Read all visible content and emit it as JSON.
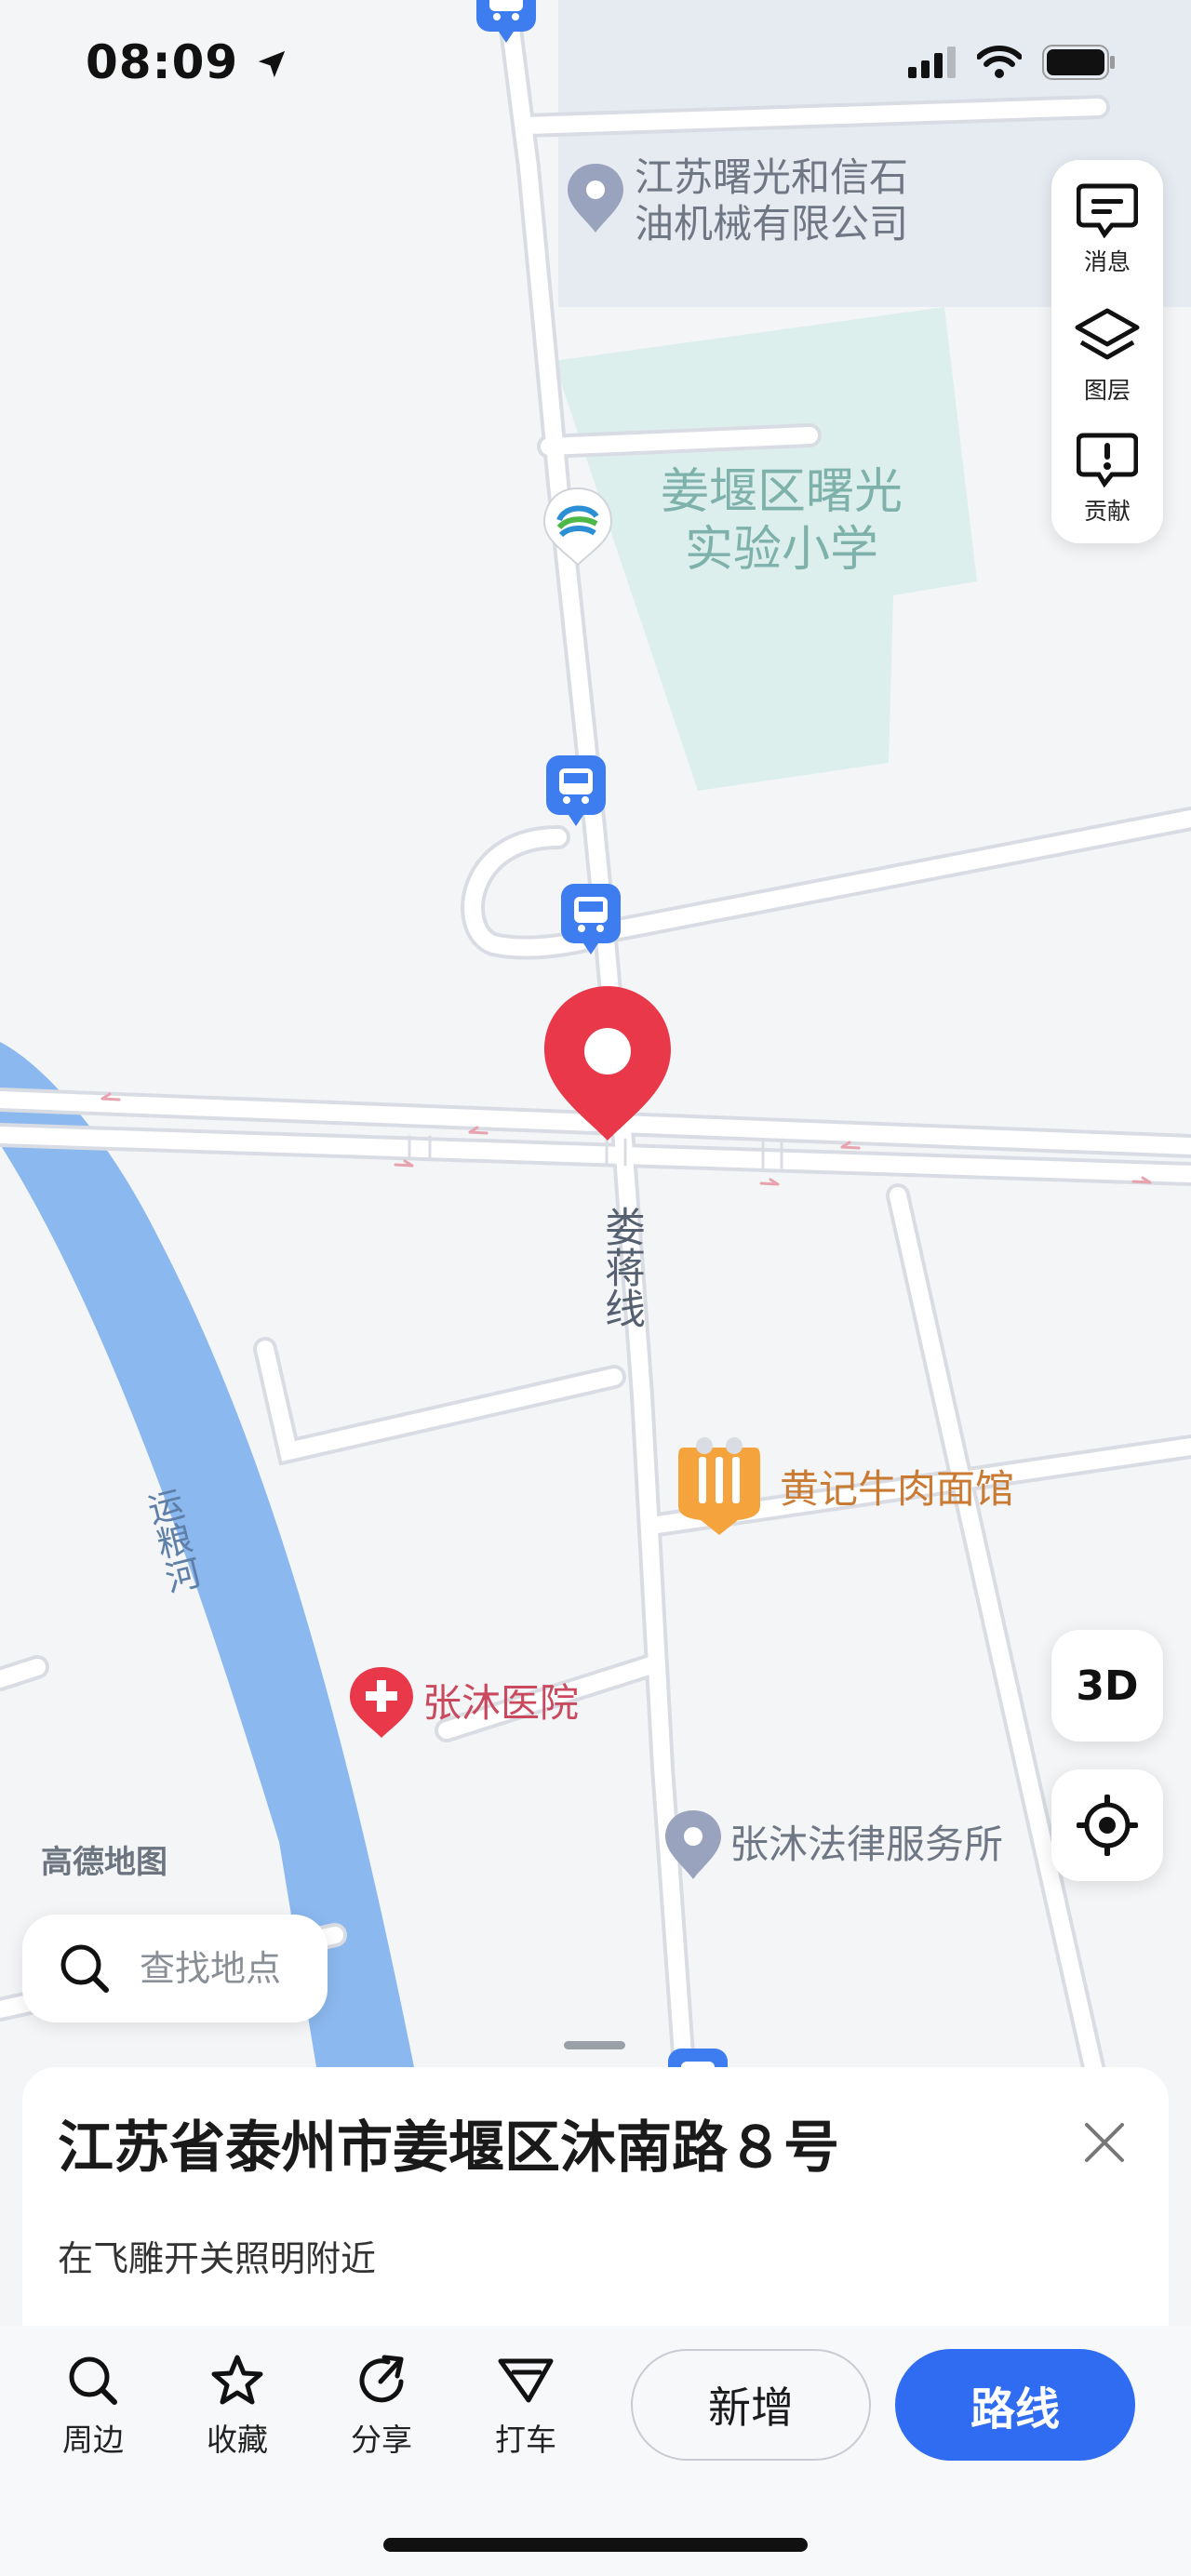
{
  "status_bar": {
    "time": "08:09"
  },
  "map_controls": {
    "messages_label": "消息",
    "layers_label": "图层",
    "contribute_label": "贡献",
    "mode_3d_label": "3D"
  },
  "map_labels": {
    "company_line1": "江苏曙光和信石",
    "company_line2": "油机械有限公司",
    "school_line1": "姜堰区曙光",
    "school_line2": "实验小学",
    "road_name": "娄蒋线",
    "restaurant": "黄记牛肉面馆",
    "river": "运粮河",
    "hospital": "张沐医院",
    "law_firm": "张沐法律服务所",
    "watermark": "高德地图"
  },
  "search": {
    "placeholder": "查找地点"
  },
  "place_card": {
    "title": "江苏省泰州市姜堰区沐南路８号",
    "subtitle": "在飞雕开关照明附近"
  },
  "toolbar": {
    "nearby_label": "周边",
    "favorite_label": "收藏",
    "share_label": "分享",
    "taxi_label": "打车",
    "add_label": "新增",
    "route_label": "路线"
  },
  "colors": {
    "accent_blue": "#2f6cf2",
    "pin_red": "#e8384a",
    "river_blue": "#8bb8ef",
    "road_white": "#ffffff",
    "school_area": "#dcefed"
  }
}
